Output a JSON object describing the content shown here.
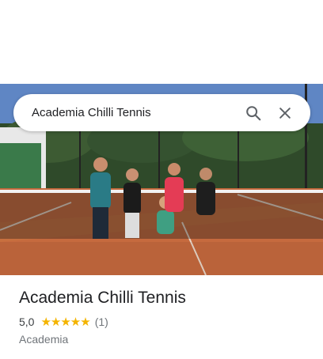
{
  "search": {
    "query": "Academia Chilli Tennis",
    "search_icon": "search-icon",
    "close_icon": "close-icon"
  },
  "photo": {
    "subject": "kids-tennis-group-photo"
  },
  "place": {
    "name": "Academia Chilli Tennis",
    "rating": "5,0",
    "stars": "★★★★★",
    "review_count": "(1)",
    "category": "Academia"
  },
  "colors": {
    "star": "#f4b400",
    "title": "#202124",
    "secondary": "#70757a"
  }
}
